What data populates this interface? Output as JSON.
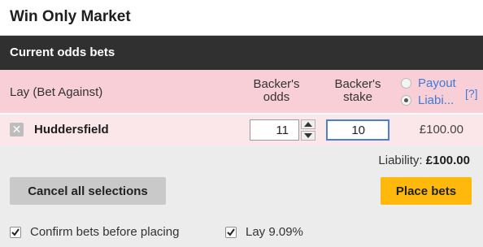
{
  "market": {
    "title": "Win Only Market"
  },
  "section": {
    "title": "Current odds bets"
  },
  "columns": {
    "bet_type": "Lay (Bet Against)",
    "odds_line1": "Backer's",
    "odds_line2": "odds",
    "stake_line1": "Backer's",
    "stake_line2": "stake",
    "radio_payout": "Payout",
    "radio_liability": "Liabi...",
    "help": "[?]",
    "selected_mode": "liability"
  },
  "selection": {
    "runner": "Huddersfield",
    "remove_glyph": "✕",
    "odds_value": "11",
    "stake_value": "10",
    "liability": "£100.00"
  },
  "footer": {
    "liability_label": "Liability:",
    "liability_total": "£100.00",
    "cancel_label": "Cancel all selections",
    "place_label": "Place bets",
    "confirm_label": "Confirm bets before placing",
    "confirm_checked": true,
    "lay_label": "Lay 9.09%",
    "lay_checked": true
  },
  "colors": {
    "header_bg": "#303030",
    "lay_pink": "#f9cfd7",
    "place_button": "#ffb80c",
    "link_blue": "#3e7ad6"
  }
}
